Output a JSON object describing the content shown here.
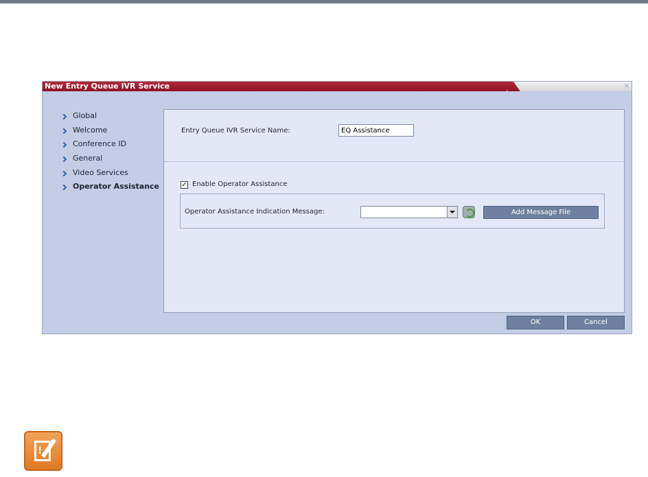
{
  "dialog": {
    "title": "New Entry Queue IVR Service",
    "close_glyph": "×"
  },
  "nav": {
    "items": [
      {
        "label": "Global"
      },
      {
        "label": "Welcome"
      },
      {
        "label": "Conference ID"
      },
      {
        "label": "General"
      },
      {
        "label": "Video Services"
      },
      {
        "label": "Operator Assistance",
        "active": true
      }
    ]
  },
  "form": {
    "service_name_label": "Entry Queue IVR Service Name:",
    "service_name_value": "EQ Assistance",
    "enable_operator_label": "Enable Operator Assistance",
    "enable_operator_checked": true,
    "checkbox_glyph": "✓",
    "indication_message_label": "Operator Assistance Indication Message:",
    "indication_message_value": "",
    "add_message_file_label": "Add Message File"
  },
  "footer": {
    "ok_label": "OK",
    "cancel_label": "Cancel"
  },
  "note": {
    "icon": "note-pencil-icon",
    "icon_glyph": "!"
  },
  "colors": {
    "title_bar": "#9e1c2e",
    "dialog_bg": "#c3cde6",
    "panel_bg": "#e3e8f7",
    "button_bg": "#6f80a0",
    "note_icon": "#e8882e"
  }
}
